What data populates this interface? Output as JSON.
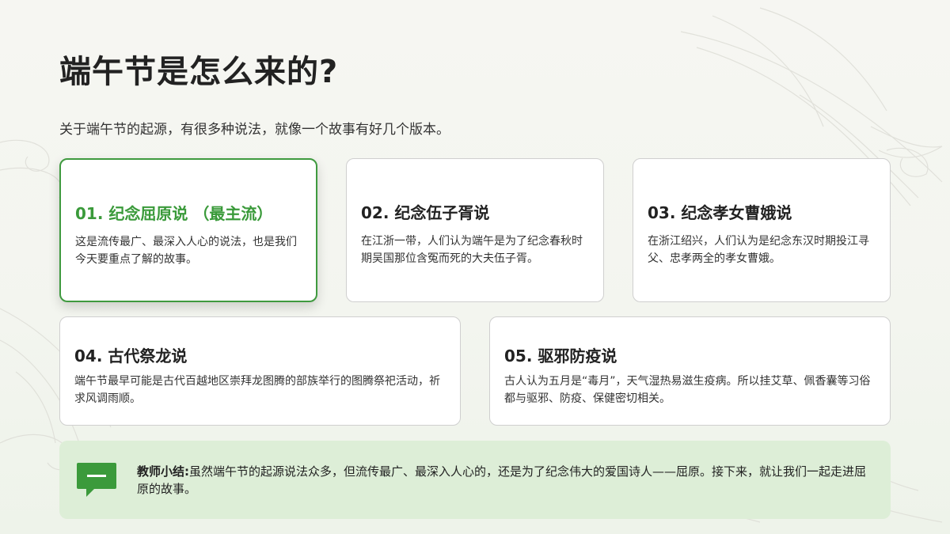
{
  "slide": {
    "title": "端午节是怎么来的?",
    "subtitle": "关于端午节的起源，有很多种说法，就像一个故事有好几个版本。"
  },
  "cards": [
    {
      "title": "01. 纪念屈原说 （最主流）",
      "description": "这是流传最广、最深入人心的说法，也是我们今天要重点了解的故事。"
    },
    {
      "title": "02. 纪念伍子胥说",
      "description": "在江浙一带，人们认为端午是为了纪念春秋时期吴国那位含冤而死的大夫伍子胥。"
    },
    {
      "title": "03. 纪念孝女曹娥说",
      "description": "在浙江绍兴，人们认为是纪念东汉时期投江寻父、忠孝两全的孝女曹娥。"
    },
    {
      "title": "04. 古代祭龙说",
      "description": "端午节最早可能是古代百越地区崇拜龙图腾的部族举行的图腾祭祀活动，祈求风调雨顺。"
    },
    {
      "title": "05. 驱邪防疫说",
      "description": "古人认为五月是“毒月”，天气湿热易滋生疫病。所以挂艾草、佩香囊等习俗都与驱邪、防疫、保健密切相关。"
    }
  ],
  "summary": {
    "label": "教师小结:",
    "text": "虽然端午节的起源说法众多，但流传最广、最深入人心的，还是为了纪念伟大的爱国诗人——屈原。接下来，就让我们一起走进屈原的故事。",
    "icon": "chat-bubble-icon"
  },
  "colors": {
    "accent": "#3a9a3a",
    "summary_bg": "#ddeed7",
    "card_border": "#cfcfcf"
  }
}
